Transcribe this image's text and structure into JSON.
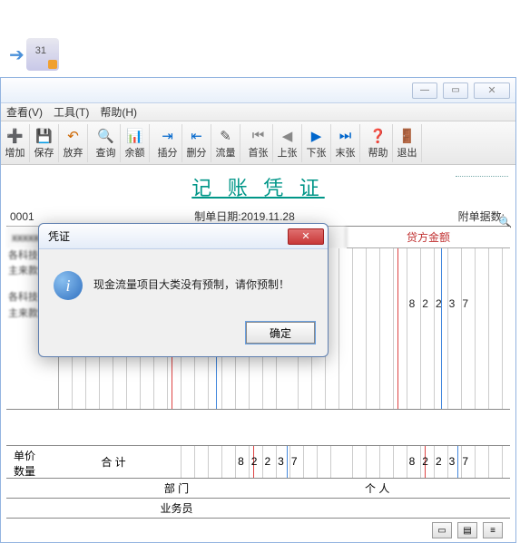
{
  "desktop": {
    "icon_day": "31"
  },
  "window": {
    "controls": {
      "min": "—",
      "max": "▭",
      "close": "✕"
    }
  },
  "menu": {
    "view": "查看(V)",
    "tools": "工具(T)",
    "help": "帮助(H)"
  },
  "toolbar": [
    {
      "name": "add-button",
      "icon": "➕",
      "label": "增加",
      "color": "#2a8"
    },
    {
      "name": "save-button",
      "icon": "💾",
      "label": "保存",
      "color": "#333"
    },
    {
      "name": "discard-button",
      "icon": "↶",
      "label": "放弃",
      "color": "#c60"
    },
    {
      "name": "sep"
    },
    {
      "name": "query-button",
      "icon": "🔍",
      "label": "查询",
      "color": "#333"
    },
    {
      "name": "balance-button",
      "icon": "📊",
      "label": "余额",
      "color": "#c33"
    },
    {
      "name": "sep"
    },
    {
      "name": "insert-button",
      "icon": "⇥",
      "label": "插分",
      "color": "#06c"
    },
    {
      "name": "delete-button",
      "icon": "⇤",
      "label": "删分",
      "color": "#06c"
    },
    {
      "name": "flow-button",
      "icon": "✎",
      "label": "流量",
      "color": "#555"
    },
    {
      "name": "sep"
    },
    {
      "name": "first-button",
      "icon": "⏮",
      "label": "首张",
      "color": "#888"
    },
    {
      "name": "prev-button",
      "icon": "◀",
      "label": "上张",
      "color": "#888"
    },
    {
      "name": "next-button",
      "icon": "▶",
      "label": "下张",
      "color": "#06c"
    },
    {
      "name": "last-button",
      "icon": "⏭",
      "label": "末张",
      "color": "#06c"
    },
    {
      "name": "sep"
    },
    {
      "name": "help-button",
      "icon": "❓",
      "label": "帮助",
      "color": "#cc0"
    },
    {
      "name": "exit-button",
      "icon": "🚪",
      "label": "退出",
      "color": "#c33"
    }
  ],
  "doc": {
    "title": "记 账 凭 证",
    "seq": "0001",
    "date_label": "制单日期:",
    "date_value": "2019.11.28",
    "attach_label": "附单据数:",
    "credit_header": "贷方金额",
    "desc1": "各科技 1",
    "desc2": "主来款",
    "desc3": "各科技",
    "desc4": "主来款 |",
    "value1": "82237",
    "unit_price": "单价",
    "quantity": "数量",
    "total_label": "合 计",
    "sum1": "82237",
    "sum2": "82237",
    "dept": "部 门",
    "owner": "业务员",
    "person": "个 人"
  },
  "dialog": {
    "title": "凭证",
    "message": "现金流量项目大类没有预制，请你预制！",
    "ok": "确定"
  }
}
